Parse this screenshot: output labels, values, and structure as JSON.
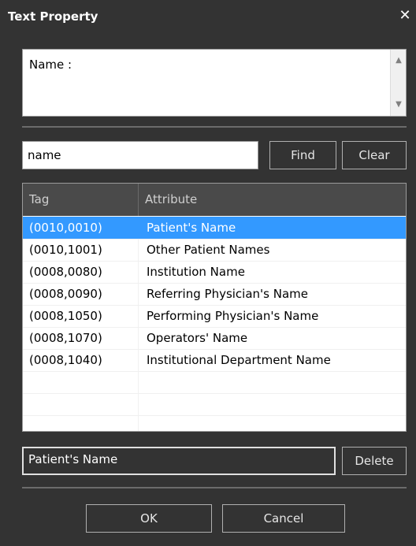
{
  "dialog": {
    "title": "Text Property",
    "close_glyph": "✕"
  },
  "name_area": {
    "label": "Name :"
  },
  "search": {
    "value": "name"
  },
  "buttons": {
    "find": "Find",
    "clear": "Clear",
    "delete": "Delete",
    "ok": "OK",
    "cancel": "Cancel"
  },
  "table": {
    "headers": {
      "tag": "Tag",
      "attribute": "Attribute"
    },
    "rows": [
      {
        "tag": "(0010,0010)",
        "attribute": "Patient's Name",
        "selected": true
      },
      {
        "tag": "(0010,1001)",
        "attribute": "Other Patient Names"
      },
      {
        "tag": "(0008,0080)",
        "attribute": "Institution Name"
      },
      {
        "tag": "(0008,0090)",
        "attribute": "Referring Physician's Name"
      },
      {
        "tag": "(0008,1050)",
        "attribute": "Performing Physician's Name"
      },
      {
        "tag": "(0008,1070)",
        "attribute": "Operators' Name"
      },
      {
        "tag": "(0008,1040)",
        "attribute": "Institutional Department Name"
      }
    ]
  },
  "selected_tag_name": "Patient's Name",
  "colors": {
    "background": "#333333",
    "selection": "#3399ff",
    "header": "#4a4a4a"
  }
}
